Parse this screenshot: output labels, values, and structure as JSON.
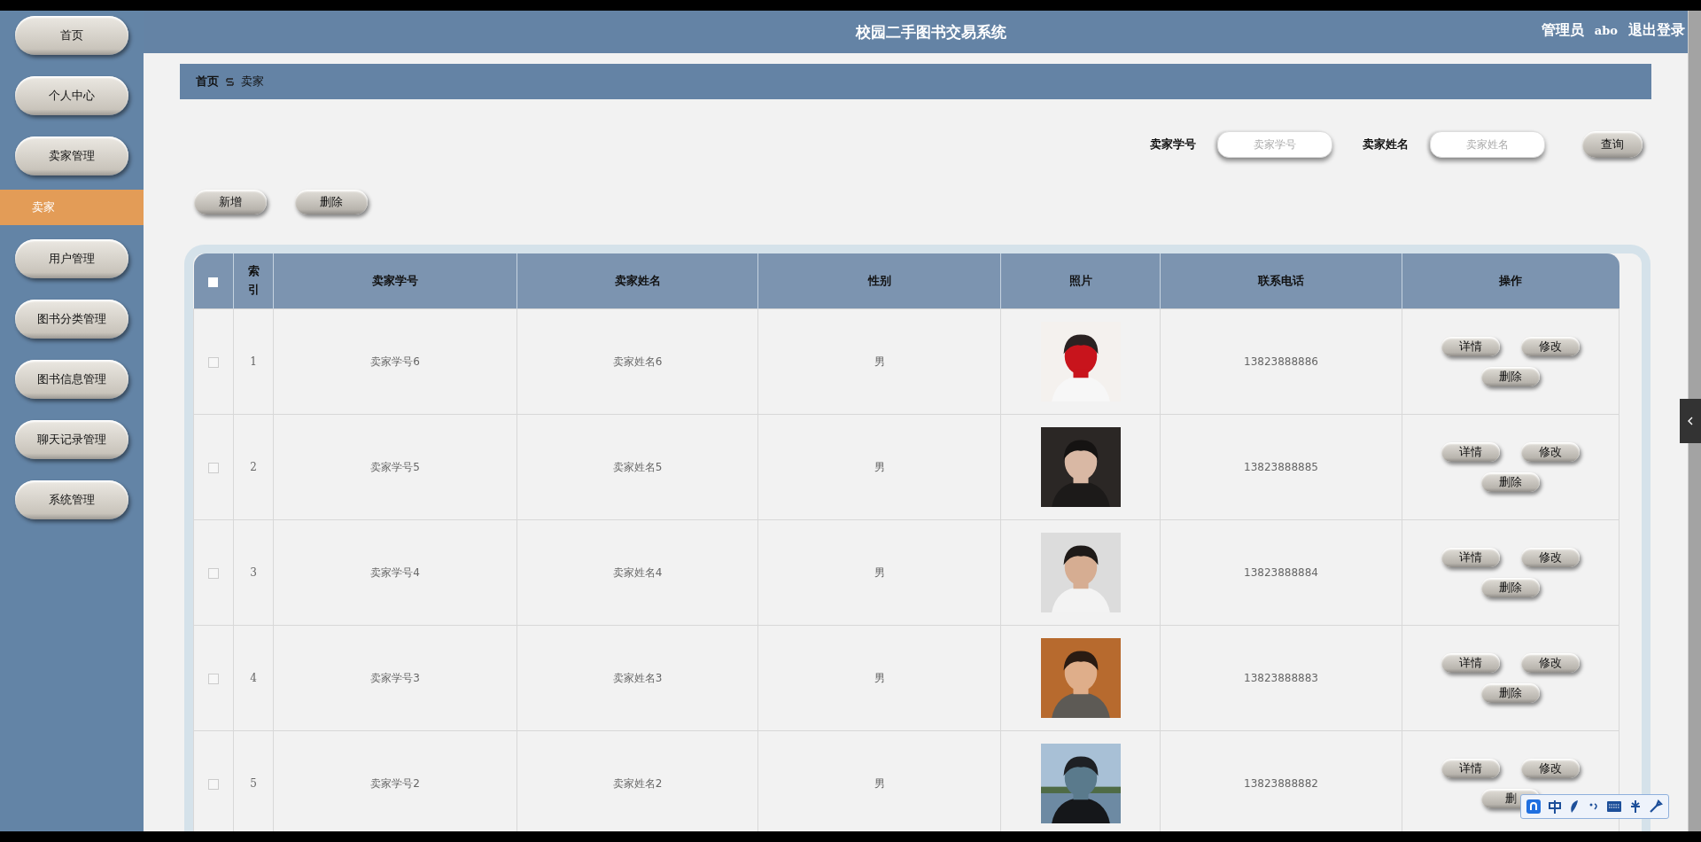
{
  "header": {
    "title": "校园二手图书交易系统",
    "role": "管理员",
    "user": "abo",
    "logout": "退出登录"
  },
  "sidebar": {
    "items": [
      {
        "label": "首页",
        "kind": "button",
        "selected": false
      },
      {
        "label": "个人中心",
        "kind": "button",
        "selected": false
      },
      {
        "label": "卖家管理",
        "kind": "button",
        "selected": false
      },
      {
        "label": "卖家",
        "kind": "subitem",
        "selected": true
      },
      {
        "label": "用户管理",
        "kind": "button",
        "selected": false
      },
      {
        "label": "图书分类管理",
        "kind": "button",
        "selected": false
      },
      {
        "label": "图书信息管理",
        "kind": "button",
        "selected": false
      },
      {
        "label": "聊天记录管理",
        "kind": "button",
        "selected": false
      },
      {
        "label": "系统管理",
        "kind": "button",
        "selected": false
      }
    ]
  },
  "breadcrumb": [
    "首页",
    "卖家"
  ],
  "search": {
    "fields": [
      {
        "label": "卖家学号",
        "placeholder": "卖家学号"
      },
      {
        "label": "卖家姓名",
        "placeholder": "卖家姓名"
      }
    ],
    "button": "查询"
  },
  "actions": [
    "新增",
    "删除"
  ],
  "table": {
    "select_all": {
      "checked": false
    },
    "columns": [
      "索引",
      "卖家学号",
      "卖家姓名",
      "性别",
      "照片",
      "联系电话",
      "操作"
    ],
    "rows": [
      {
        "checked": false,
        "index": "1",
        "id": "卖家学号6",
        "name": "卖家姓名6",
        "gender": "男",
        "phone": "13823888886",
        "buttons": [
          "详情",
          "修改",
          "删除"
        ]
      },
      {
        "checked": false,
        "index": "2",
        "id": "卖家学号5",
        "name": "卖家姓名5",
        "gender": "男",
        "phone": "13823888885",
        "buttons": [
          "详情",
          "修改",
          "删除"
        ]
      },
      {
        "checked": false,
        "index": "3",
        "id": "卖家学号4",
        "name": "卖家姓名4",
        "gender": "男",
        "phone": "13823888884",
        "buttons": [
          "详情",
          "修改",
          "删除"
        ]
      },
      {
        "checked": false,
        "index": "4",
        "id": "卖家学号3",
        "name": "卖家姓名3",
        "gender": "男",
        "phone": "13823888883",
        "buttons": [
          "详情",
          "修改",
          "删除"
        ]
      },
      {
        "checked": false,
        "index": "5",
        "id": "卖家学号2",
        "name": "卖家姓名2",
        "gender": "男",
        "phone": "13823888882",
        "buttons": [
          "详情",
          "修改",
          "删"
        ]
      }
    ]
  }
}
